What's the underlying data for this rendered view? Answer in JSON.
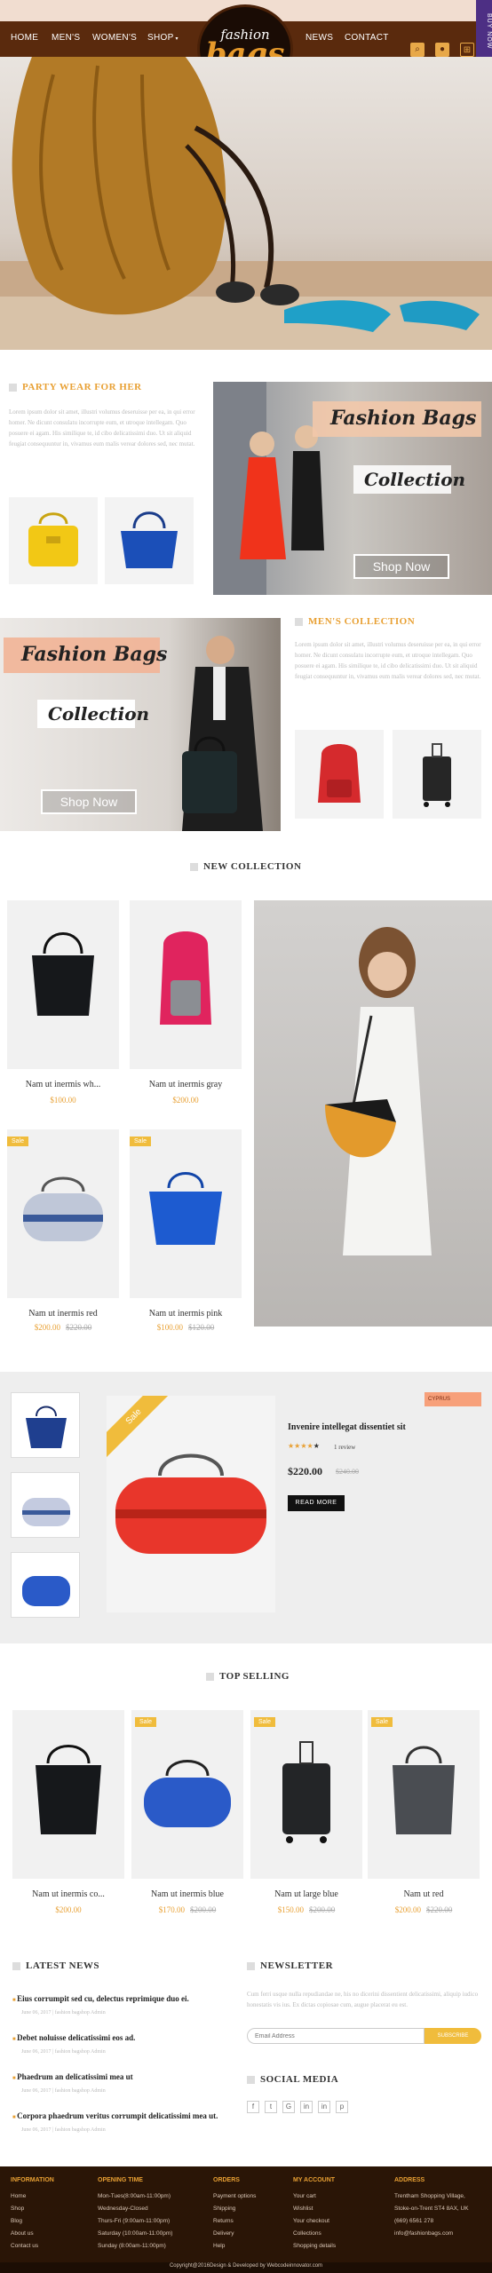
{
  "nav": {
    "home": "HOME",
    "mens": "MEN'S",
    "womens": "WOMEN'S",
    "shop": "SHOP",
    "news": "NEWS",
    "contact": "CONTACT",
    "buy_now": "BUY NOW"
  },
  "logo": {
    "line1": "fashion",
    "line2": "bags"
  },
  "party_wear": {
    "title": "PARTY WEAR FOR HER",
    "text": "Lorem ipsum dolor sit amet, illustri volumus deseruisse per ea, in qui error homer. Ne dicunt consulatu incorrupte eum, et utroque intellegam. Quo posuere ei agam. His similique te, id cibo delicatissimi duo. Ut sit aliquid feugiat consequuntur in, vivamus eum malis verear dolores sed, nec mutat."
  },
  "banner1": {
    "line1": "Fashion Bags",
    "line2": "Collection",
    "cta": "Shop Now"
  },
  "banner2": {
    "line1": "Fashion Bags",
    "line2": "Collection",
    "cta": "Shop Now"
  },
  "mens_collection": {
    "title": "MEN'S COLLECTION",
    "text": "Lorem ipsum dolor sit amet, illustri volumus deseruisse per ea, in qui error homer. Ne dicunt consulatu incorrupte eum, et utroque intellegam. Quo posuere ei agam. His similique te, id cibo delicatissimi duo. Ut sit aliquid feugiat consequuntur in, vivamus eum malis verear dolores sed, nec mutat."
  },
  "new_collection": {
    "title": "NEW COLLECTION",
    "products": [
      {
        "name": "Nam ut inermis wh...",
        "price": "$100.00",
        "old": "",
        "sale": false
      },
      {
        "name": "Nam ut inermis gray",
        "price": "$200.00",
        "old": "",
        "sale": false
      },
      {
        "name": "Nam ut inermis red",
        "price": "$200.00",
        "old": "$220.00",
        "sale": true
      },
      {
        "name": "Nam ut inermis pink",
        "price": "$100.00",
        "old": "$120.00",
        "sale": true
      }
    ],
    "sale_label": "Sale"
  },
  "featured": {
    "sale_label": "Sale",
    "corner_tag": "CYPRUS",
    "title": "Invenire intellegat dissentiet sit",
    "rating": 4,
    "reviews": "1 review",
    "price": "$220.00",
    "old_price": "$240.00",
    "cta": "READ MORE"
  },
  "top_selling": {
    "title": "TOP SELLING",
    "sale_label": "Sale",
    "products": [
      {
        "name": "Nam ut inermis co...",
        "price": "$200.00",
        "old": "",
        "sale": false
      },
      {
        "name": "Nam ut inermis blue",
        "price": "$170.00",
        "old": "$200.00",
        "sale": true
      },
      {
        "name": "Nam ut large blue",
        "price": "$150.00",
        "old": "$200.00",
        "sale": true
      },
      {
        "name": "Nam ut red",
        "price": "$200.00",
        "old": "$220.00",
        "sale": true
      }
    ]
  },
  "latest_news": {
    "title": "LATEST NEWS",
    "items": [
      {
        "title": "Eius corrumpit sed cu, delectus reprimique duo ei.",
        "meta": "June 06, 2017  |  fashion bagshop Admin"
      },
      {
        "title": "Debet noluisse delicatissimi eos ad.",
        "meta": "June 06, 2017  |  fashion bagshop Admin"
      },
      {
        "title": "Phaedrum an delicatissimi mea ut",
        "meta": "June 06, 2017  |  fashion bagshop Admin"
      },
      {
        "title": "Corpora phaedrum veritus corrumpit delicatissimi mea ut.",
        "meta": "June 06, 2017  |  fashion bagshop Admin"
      }
    ]
  },
  "newsletter": {
    "title": "NEWSLETTER",
    "text": "Cum ferri usque nulla repudiandae ne, his no dicerini dissentient delicatissimi, aliquip iudico honestatis vis ius. Ex dictas copiosae cum, augue placerat eu est.",
    "placeholder": "Email Address",
    "button": "SUBSCRIBE"
  },
  "social": {
    "title": "SOCIAL MEDIA",
    "icons": [
      "f",
      "t",
      "G",
      "in",
      "in",
      "p"
    ]
  },
  "footer": {
    "info": {
      "title": "INFORMATION",
      "items": [
        "Home",
        "Shop",
        "Blog",
        "About us",
        "Contact us"
      ]
    },
    "opening": {
      "title": "OPENING TIME",
      "items": [
        "Mon-Tues(8:00am-11:00pm)",
        "Wednesday-Closed",
        "Thurs-Fri (9:00am-11:00pm)",
        "Saturday (10:00am-11:00pm)",
        "Sunday (8:00am-11:00pm)"
      ]
    },
    "orders": {
      "title": "ORDERS",
      "items": [
        "Payment options",
        "Shipping",
        "Returns",
        "Delivery",
        "Help"
      ]
    },
    "account": {
      "title": "MY ACCOUNT",
      "items": [
        "Your cart",
        "Wishlist",
        "Your checkout",
        "Collections",
        "Shopping details"
      ]
    },
    "address": {
      "title": "ADDRESS",
      "items": [
        "Trentham Shopping Village,",
        "Stoke-on-Trent ST4 8AX, UK",
        "(669) 6561 278",
        "info@fashionbags.com"
      ]
    },
    "copyright": "Copyright@2016Design & Developed by Webcodeinnovator.com"
  },
  "colors": {
    "accent": "#e8a033",
    "brown": "#5a2a0d",
    "footer": "#2a1506"
  }
}
